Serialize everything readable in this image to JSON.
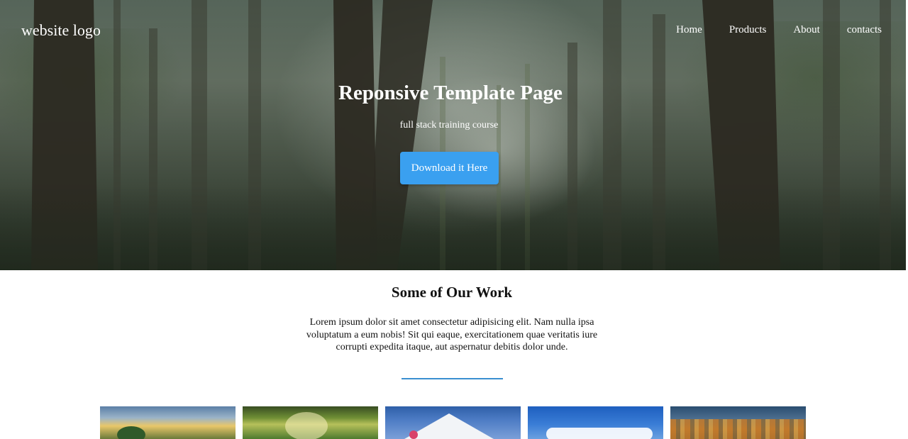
{
  "header": {
    "logo": "website logo",
    "nav": [
      {
        "label": "Home"
      },
      {
        "label": "Products"
      },
      {
        "label": "About"
      },
      {
        "label": "contacts"
      }
    ]
  },
  "hero": {
    "title": "Reponsive Template Page",
    "subtitle": "full stack training course",
    "cta_label": "Download it Here",
    "cta_color": "#3aa0f0"
  },
  "work": {
    "title": "Some of Our Work",
    "text": "Lorem ipsum dolor sit amet consectetur adipisicing elit. Nam nulla ipsa voluptatum a eum nobis! Sit qui eaque, exercitationem quae veritatis iure corrupti expedita itaque, aut aspernatur debitis dolor unde.",
    "divider_color": "#3a8fd0",
    "gallery": [
      {
        "subject": "sunset-landscape"
      },
      {
        "subject": "sunlit-forest"
      },
      {
        "subject": "snowy-mountain"
      },
      {
        "subject": "blue-sky-clouds"
      },
      {
        "subject": "autumn-trees"
      }
    ]
  }
}
